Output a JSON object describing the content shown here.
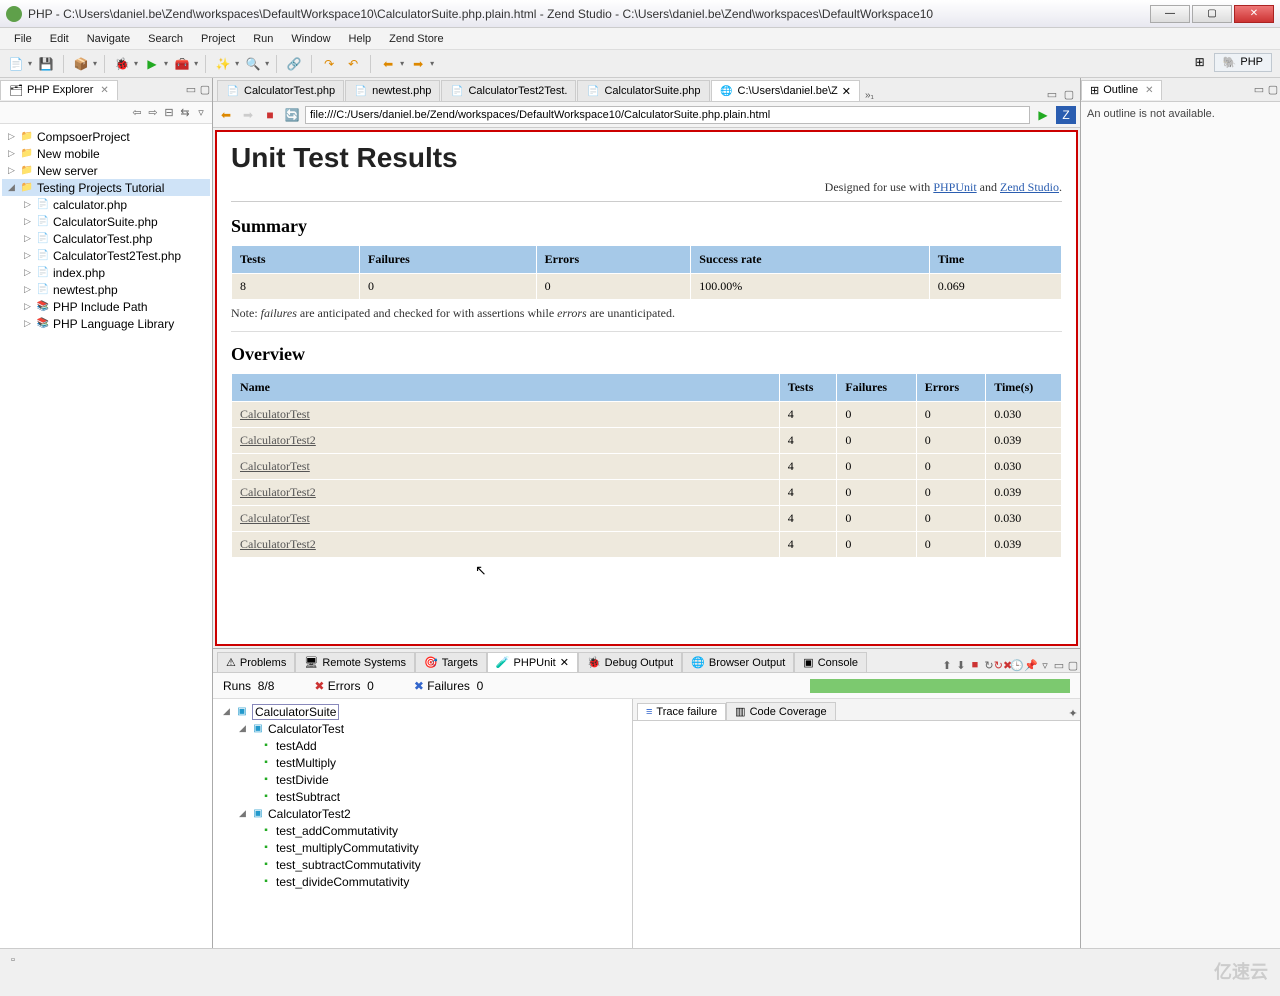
{
  "window": {
    "title": "PHP - C:\\Users\\daniel.be\\Zend\\workspaces\\DefaultWorkspace10\\CalculatorSuite.php.plain.html - Zend Studio - C:\\Users\\daniel.be\\Zend\\workspaces\\DefaultWorkspace10",
    "min": "—",
    "max": "▢",
    "close": "✕"
  },
  "menu": [
    "File",
    "Edit",
    "Navigate",
    "Search",
    "Project",
    "Run",
    "Window",
    "Help",
    "Zend Store"
  ],
  "perspective": "PHP",
  "explorer": {
    "title": "PHP Explorer",
    "projects": [
      {
        "name": "CompsoerProject",
        "type": "proj"
      },
      {
        "name": "New mobile",
        "type": "proj"
      },
      {
        "name": "New server",
        "type": "proj"
      }
    ],
    "open_project": {
      "name": "Testing Projects Tutorial",
      "files": [
        "calculator.php",
        "CalculatorSuite.php",
        "CalculatorTest.php",
        "CalculatorTest2Test.php",
        "index.php",
        "newtest.php"
      ],
      "libs": [
        "PHP Include Path",
        "PHP Language Library"
      ]
    }
  },
  "editor": {
    "tabs": [
      {
        "label": "CalculatorTest.php",
        "icon": "php"
      },
      {
        "label": "newtest.php",
        "icon": "php"
      },
      {
        "label": "CalculatorTest2Test.",
        "icon": "php"
      },
      {
        "label": "CalculatorSuite.php",
        "icon": "php"
      },
      {
        "label": "C:\\Users\\daniel.be\\Z",
        "icon": "web",
        "active": true
      }
    ],
    "more": "»₁",
    "url": "file:///C:/Users/daniel.be/Zend/workspaces/DefaultWorkspace10/CalculatorSuite.php.plain.html"
  },
  "report": {
    "h1": "Unit Test Results",
    "designed_prefix": "Designed for use with ",
    "link1": "PHPUnit",
    "and": " and ",
    "link2": "Zend Studio",
    "dot": ".",
    "summary_h": "Summary",
    "summary_cols": [
      "Tests",
      "Failures",
      "Errors",
      "Success rate",
      "Time"
    ],
    "summary_row": [
      "8",
      "0",
      "0",
      "100.00%",
      "0.069"
    ],
    "note_a": "Note: ",
    "note_i1": "failures",
    "note_b": " are anticipated and checked for with assertions while ",
    "note_i2": "errors",
    "note_c": " are unanticipated.",
    "overview_h": "Overview",
    "ov_cols": [
      "Name",
      "Tests",
      "Failures",
      "Errors",
      "Time(s)"
    ],
    "ov_rows": [
      {
        "name": "CalculatorTest",
        "t": "4",
        "f": "0",
        "e": "0",
        "s": "0.030"
      },
      {
        "name": "CalculatorTest2",
        "t": "4",
        "f": "0",
        "e": "0",
        "s": "0.039"
      },
      {
        "name": "CalculatorTest",
        "t": "4",
        "f": "0",
        "e": "0",
        "s": "0.030"
      },
      {
        "name": "CalculatorTest2",
        "t": "4",
        "f": "0",
        "e": "0",
        "s": "0.039"
      },
      {
        "name": "CalculatorTest",
        "t": "4",
        "f": "0",
        "e": "0",
        "s": "0.030"
      },
      {
        "name": "CalculatorTest2",
        "t": "4",
        "f": "0",
        "e": "0",
        "s": "0.039"
      }
    ]
  },
  "bottom": {
    "tabs": [
      "Problems",
      "Remote Systems",
      "Targets",
      "PHPUnit",
      "Debug Output",
      "Browser Output",
      "Console"
    ],
    "active": 3,
    "runs_label": "Runs",
    "runs": "8/8",
    "errors_label": "Errors",
    "errors": "0",
    "failures_label": "Failures",
    "failures": "0",
    "tree": {
      "suite": "CalculatorSuite",
      "groups": [
        {
          "name": "CalculatorTest",
          "tests": [
            "testAdd",
            "testMultiply",
            "testDivide",
            "testSubtract"
          ]
        },
        {
          "name": "CalculatorTest2",
          "tests": [
            "test_addCommutativity",
            "test_multiplyCommutativity",
            "test_subtractCommutativity",
            "test_divideCommutativity"
          ]
        }
      ]
    },
    "rtabs": [
      "Trace failure",
      "Code Coverage"
    ]
  },
  "outline": {
    "title": "Outline",
    "msg": "An outline is not available."
  },
  "watermark": "亿速云"
}
